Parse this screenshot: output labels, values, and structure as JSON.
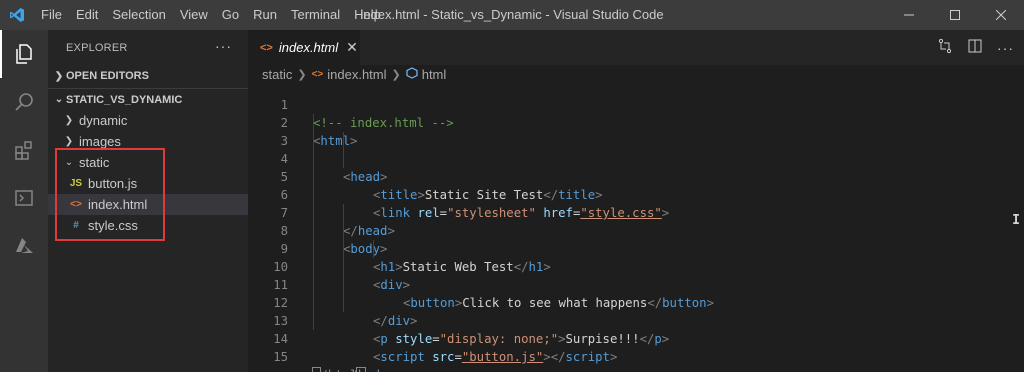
{
  "window": {
    "title": "index.html - Static_vs_Dynamic - Visual Studio Code",
    "menu": [
      "File",
      "Edit",
      "Selection",
      "View",
      "Go",
      "Run",
      "Terminal",
      "Help"
    ]
  },
  "sidebar": {
    "header": "EXPLORER",
    "more": "···",
    "open_editors": "OPEN EDITORS",
    "project": "STATIC_VS_DYNAMIC",
    "tree": [
      {
        "label": "dynamic",
        "kind": "folder",
        "expanded": false
      },
      {
        "label": "images",
        "kind": "folder",
        "expanded": false
      },
      {
        "label": "static",
        "kind": "folder",
        "expanded": true
      },
      {
        "label": "button.js",
        "kind": "js",
        "icon_text": "JS"
      },
      {
        "label": "index.html",
        "kind": "html",
        "icon_text": "<>",
        "selected": true
      },
      {
        "label": "style.css",
        "kind": "css",
        "icon_text": "#"
      }
    ]
  },
  "editor": {
    "tab_label": "index.html",
    "breadcrumbs": [
      "static",
      "index.html",
      "html"
    ],
    "line_numbers": [
      "1",
      "2",
      "3",
      "4",
      "5",
      "6",
      "7",
      "8",
      "9",
      "10",
      "11",
      "12",
      "13",
      "14",
      "15"
    ],
    "code": {
      "l1": "<!-- index.html -->",
      "l2": "html",
      "l3": "head",
      "l4_title_text": "Static Site Test",
      "l5_rel_val": "\"stylesheet\"",
      "l5_href_val": "\"style.css\"",
      "l8_h1_text": "Static Web Test",
      "l10_button_text": "Click to see what happens",
      "l12_style_val": "\"display: none;\"",
      "l12_p_text": "Surpise!!!",
      "l13_src_val": "\"button.js\""
    }
  },
  "colors": {
    "activity_bar": "#333333",
    "sidebar": "#252526",
    "editor": "#1e1e1e",
    "titlebar": "#3c3c3c",
    "highlight_box": "#e03a3a"
  }
}
